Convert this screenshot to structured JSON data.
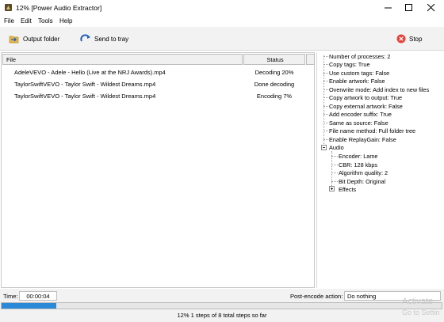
{
  "window": {
    "title": "12% [Power Audio Extractor]"
  },
  "menu": [
    "File",
    "Edit",
    "Tools",
    "Help"
  ],
  "toolbar": {
    "output_folder": "Output folder",
    "send_to_tray": "Send to tray",
    "stop": "Stop"
  },
  "files": {
    "headers": {
      "file": "File",
      "status": "Status"
    },
    "rows": [
      {
        "name": "AdeleVEVO - Adele - Hello (Live at the NRJ Awards).mp4",
        "status": "Decoding 20%"
      },
      {
        "name": "TaylorSwiftVEVO - Taylor Swift - Wildest Dreams.mp4",
        "status": "Done decoding"
      },
      {
        "name": "TaylorSwiftVEVO - Taylor Swift - Wildest Dreams.mp4",
        "status": "Encoding 7%"
      }
    ]
  },
  "options": {
    "items": [
      "Number of processes: 2",
      "Copy tags: True",
      "Use custom tags: False",
      "Enable artwork: False",
      "Overwrite mode: Add index to new files",
      "Copy artwork to output: True",
      "Copy external artwork: False",
      "Add encoder suffix: True",
      "Same as source: False",
      "File name method: Full folder tree",
      "Enable ReplayGain: False"
    ],
    "audio_label": "Audio",
    "audio_items": [
      "Encoder: Lame",
      "CBR: 128 kbps",
      "Algorithm quality: 2",
      "Bit Depth: Original"
    ],
    "effects_label": "Effects"
  },
  "bottom": {
    "time_label": "Time:",
    "time_value": "00:00:04",
    "post_encode_label": "Post-encode action:",
    "post_encode_value": "Do nothing",
    "progress_fraction": 0.125,
    "status_text": "12% 1 steps of 8 total steps so far",
    "watermark_line1": "Activate",
    "watermark_line2": "Go to Settin"
  },
  "colors": {
    "progress": "#2a8ad8",
    "stop": "#e5423a",
    "send_tray": "#1f5fbf"
  }
}
